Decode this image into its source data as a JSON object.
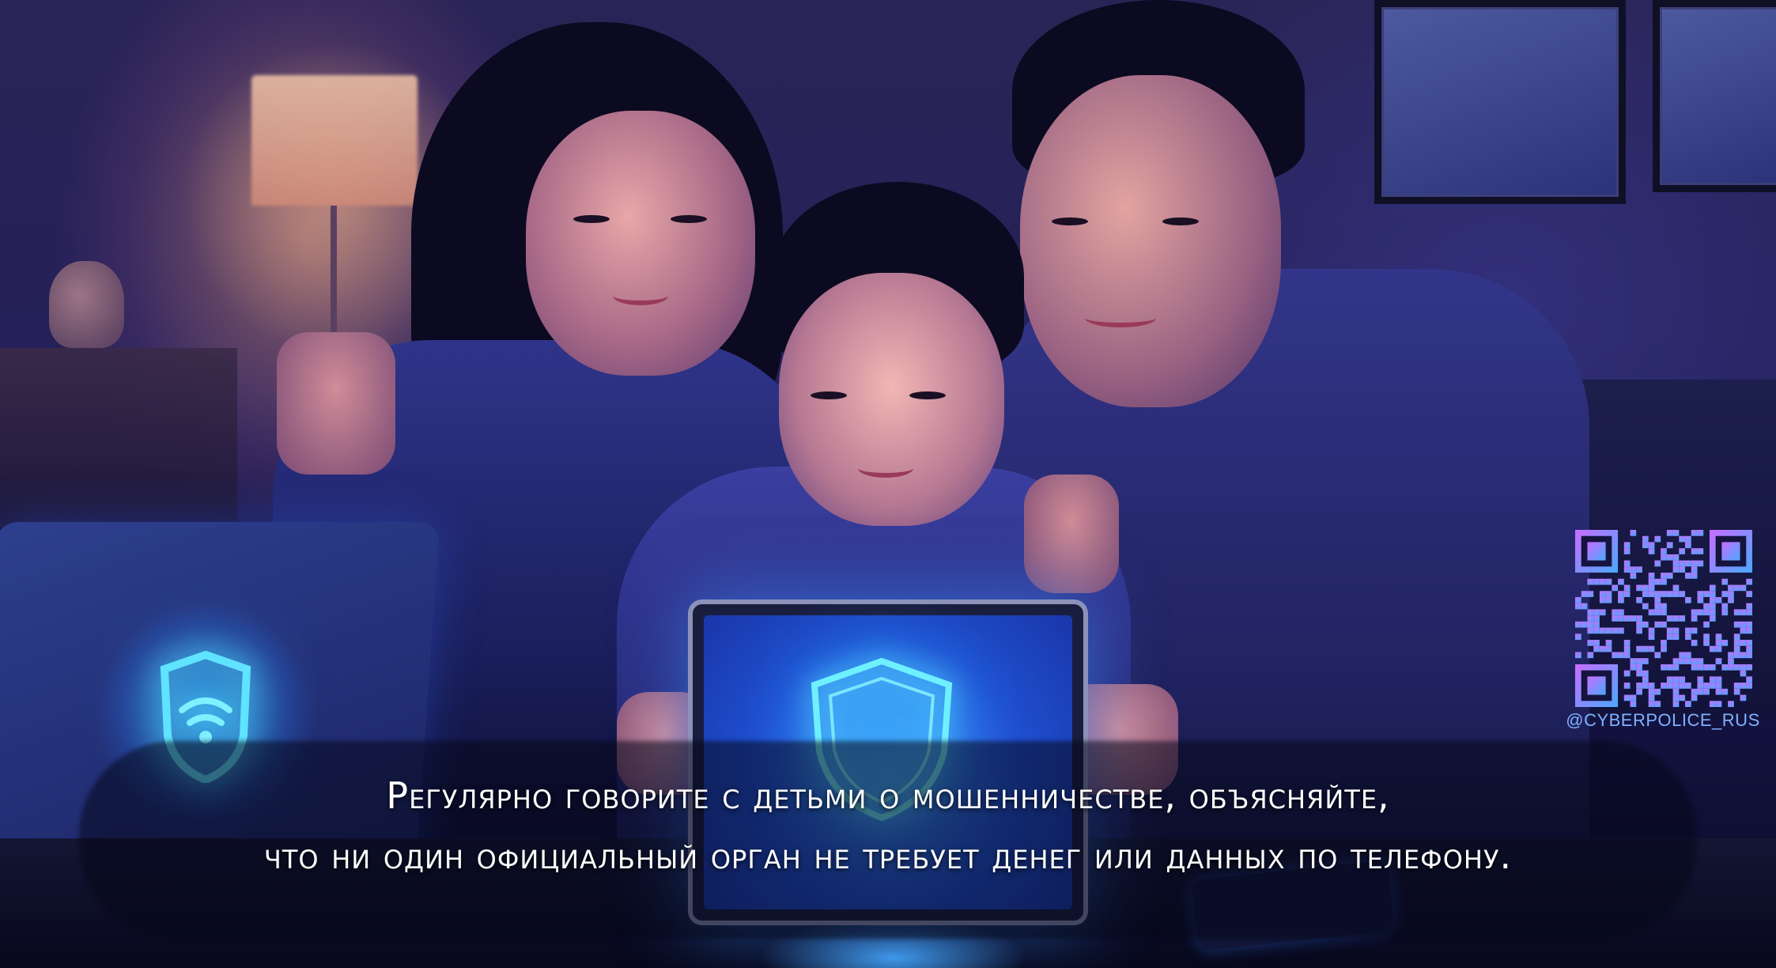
{
  "caption": {
    "line1": "Регулярно говорите с детьми о мошенничестве, объясняйте,",
    "line2": "что ни один официальный орган не требует денег или данных по телефону."
  },
  "qr": {
    "handle": "@CYBERPOLICE_RUS",
    "gradient_start": "#c86dff",
    "gradient_end": "#4aa8ff"
  },
  "colors": {
    "accent_glow": "#5fe3ff",
    "shield_glow": "#3e8cff"
  },
  "icons": {
    "laptop": "shield-wifi-icon",
    "tablet": "shield-icon"
  }
}
